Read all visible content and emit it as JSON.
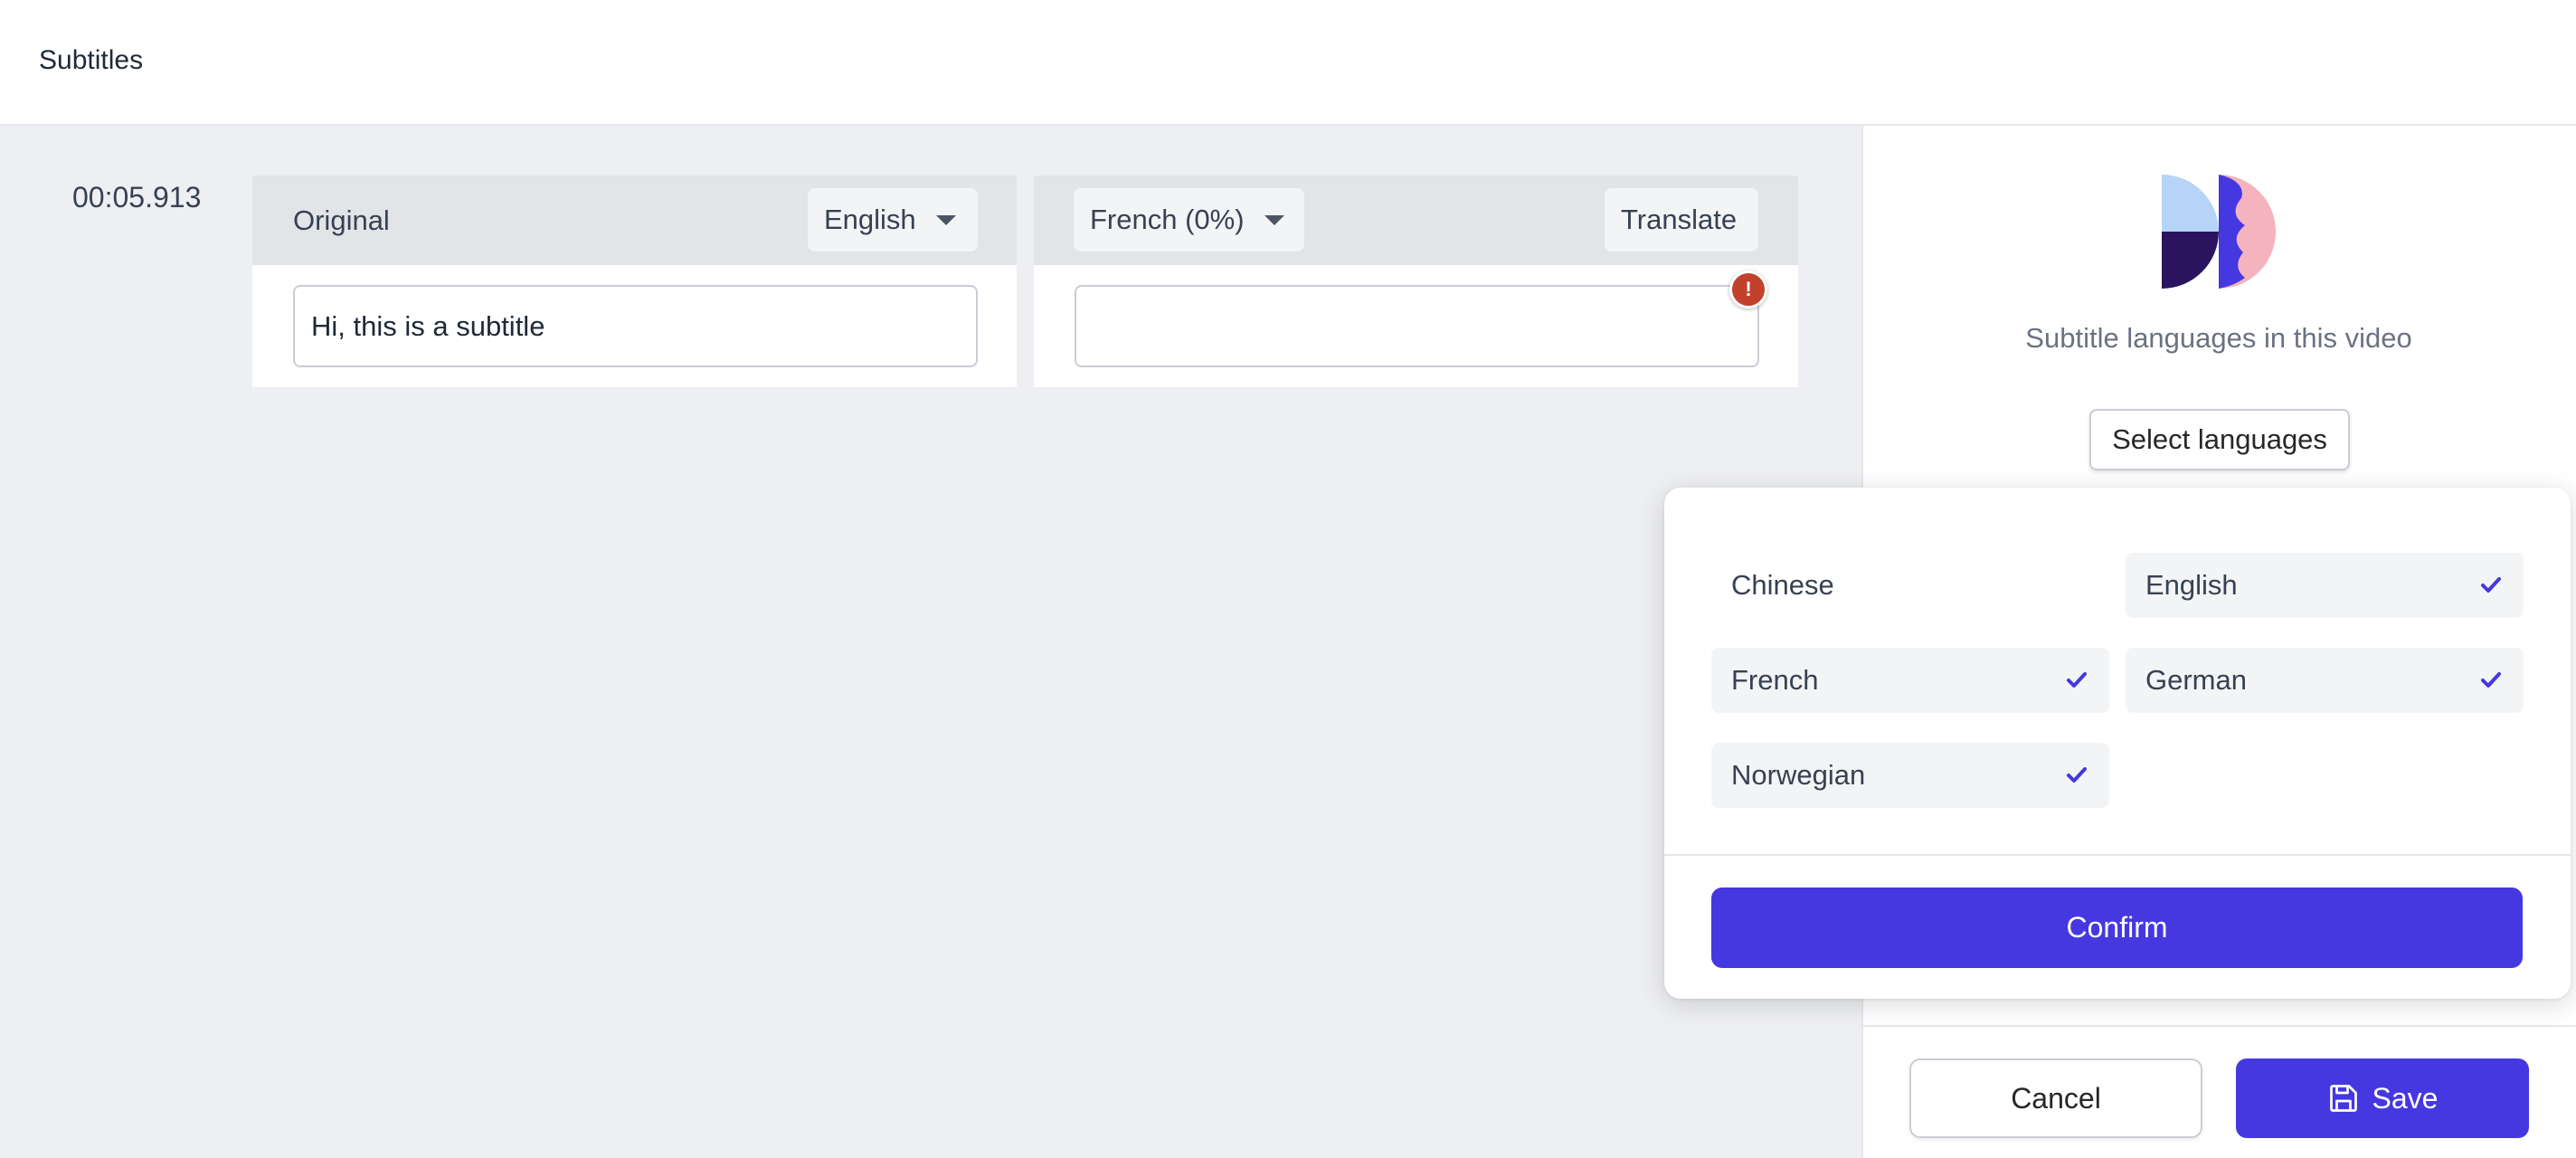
{
  "header": {
    "title": "Subtitles"
  },
  "editor": {
    "rows": [
      {
        "timestamp": "00:05.913",
        "original_text": "Hi, this is a subtitle",
        "translation_text": ""
      }
    ],
    "original_column": {
      "label": "Original",
      "language": "English"
    },
    "translation_column": {
      "language_label": "French (0%)",
      "translate_label": "Translate"
    },
    "error_badge": "!"
  },
  "sidebar": {
    "logo_icon": "split-circle-logo-icon",
    "caption": "Subtitle languages in this video",
    "select_languages_label": "Select languages",
    "cancel_label": "Cancel",
    "save_label": "Save"
  },
  "language_picker": {
    "languages": [
      {
        "name": "Chinese",
        "selected": false
      },
      {
        "name": "English",
        "selected": true
      },
      {
        "name": "French",
        "selected": true
      },
      {
        "name": "German",
        "selected": true
      },
      {
        "name": "Norwegian",
        "selected": true
      }
    ],
    "confirm_label": "Confirm"
  },
  "colors": {
    "accent": "#4538e0",
    "error": "#c2412c",
    "logo_light_blue": "#b6d4f7",
    "logo_dark_purple": "#2a1460",
    "logo_pink": "#f4b3bd"
  }
}
